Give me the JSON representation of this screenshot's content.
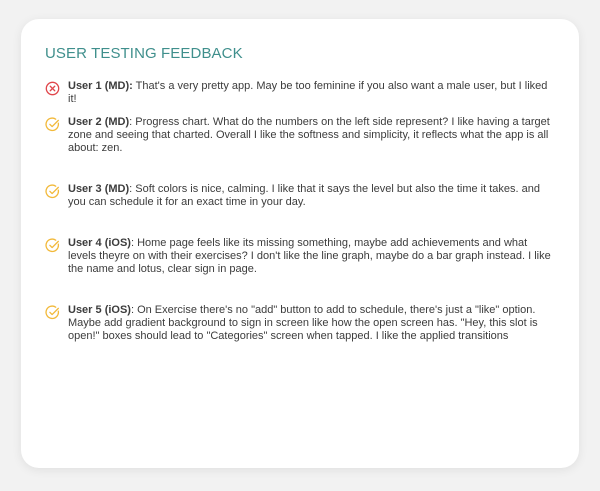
{
  "card": {
    "title": "USER TESTING FEEDBACK"
  },
  "feedback": [
    {
      "status": "negative",
      "icon": "x-circle-icon",
      "user": "User 1 (MD):",
      "comment": " That's a very pretty app. May be too feminine if you also want a male user, but I liked it!"
    },
    {
      "status": "positive",
      "icon": "check-circle-icon",
      "user": "User 2 (MD)",
      "comment": ": Progress chart. What do the numbers on the left side represent? I like having a target zone and seeing that charted. Overall I like the softness and simplicity, it reflects what the app is all about: zen."
    },
    {
      "status": "positive",
      "icon": "check-circle-icon",
      "user": "User 3 (MD)",
      "comment": ": Soft colors is nice, calming. I like that it says the level but also the time it takes. and you can schedule it for an exact time in your day."
    },
    {
      "status": "positive",
      "icon": "check-circle-icon",
      "user": "User 4 (iOS)",
      "comment": ": Home page feels like its missing something, maybe add achievements and what levels theyre on with their exercises? I don't like the line graph, maybe do a bar graph instead. I like the name and lotus, clear sign in page."
    },
    {
      "status": "positive",
      "icon": "check-circle-icon",
      "user": "User 5 (iOS)",
      "comment": ": On Exercise there's no \"add\" button to add to schedule, there's just a \"like\" option. Maybe add gradient background to sign in screen like how the open screen has. \"Hey, this slot is open!\" boxes should lead to \"Categories\" screen when tapped. I like the applied transitions"
    }
  ],
  "colors": {
    "title": "#3f8f8c",
    "negative_icon": "#e0474c",
    "positive_icon": "#f2b93a",
    "text": "#3c3c3c"
  }
}
